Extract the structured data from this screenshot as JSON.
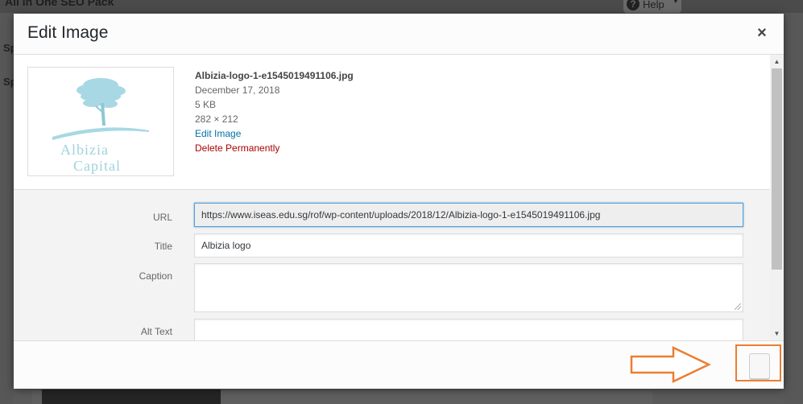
{
  "background": {
    "plugin_name": "All in One SEO Pack",
    "help_label": "Help",
    "side_labels": [
      "Sp",
      "Sp"
    ]
  },
  "modal": {
    "title": "Edit Image",
    "close_glyph": "×"
  },
  "attachment": {
    "filename": "Albizia-logo-1-e1545019491106.jpg",
    "date": "December 17, 2018",
    "filesize": "5 KB",
    "dimensions": "282 × 212",
    "edit_link": "Edit Image",
    "delete_link": "Delete Permanently",
    "logo": {
      "line1": "Albizia",
      "line2": "Capital",
      "color": "#9fd3df"
    }
  },
  "fields": {
    "url": {
      "label": "URL",
      "value": "https://www.iseas.edu.sg/rof/wp-content/uploads/2018/12/Albizia-logo-1-e1545019491106.jpg"
    },
    "title": {
      "label": "Title",
      "value": "Albizia logo"
    },
    "caption": {
      "label": "Caption",
      "value": ""
    },
    "alt_text": {
      "label": "Alt Text",
      "value": ""
    }
  },
  "colors": {
    "annotation": "#ed7d31",
    "link": "#0073aa",
    "delete": "#aa0000"
  }
}
